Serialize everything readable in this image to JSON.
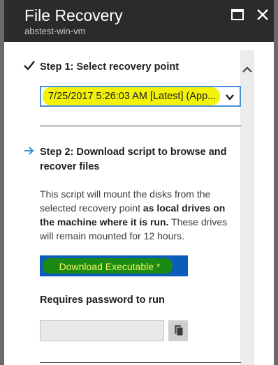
{
  "window": {
    "title": "File Recovery",
    "subtitle": "abstest-win-vm"
  },
  "step1": {
    "label": "Step 1: Select recovery point",
    "recovery_point_value": "7/25/2017 5:26:03 AM [Latest] (App..."
  },
  "step2": {
    "label": "Step 2: Download script to browse and recover files",
    "desc_part1": "This script will mount the disks from the selected recovery point ",
    "desc_bold": "as local drives on the machine where it is run.",
    "desc_part2": " These drives will remain mounted for 12 hours.",
    "download_label": "Download Executable *"
  },
  "password": {
    "label": "Requires password to run",
    "value": ""
  },
  "colors": {
    "header_bg": "#2b2b2b",
    "accent_blue": "#0a5db8",
    "highlight_yellow": "#f2f20a",
    "highlight_green": "#1b8a14"
  }
}
